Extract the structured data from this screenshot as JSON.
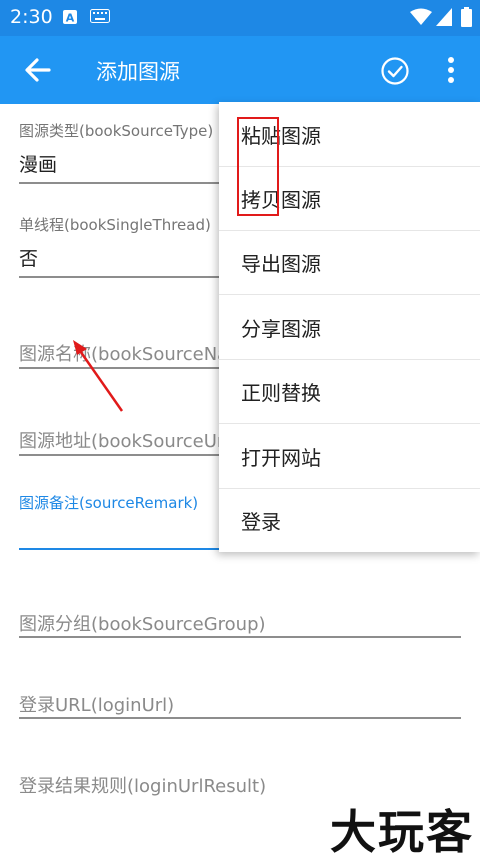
{
  "status_bar": {
    "time": "2:30"
  },
  "app_bar": {
    "title": "添加图源"
  },
  "fields": [
    {
      "label": "图源类型(bookSourceType)",
      "value": "漫画"
    },
    {
      "label": "单线程(bookSingleThread)",
      "value": "否"
    },
    {
      "placeholder": "图源名称(bookSourceName)"
    },
    {
      "placeholder": "图源地址(bookSourceUrl)"
    },
    {
      "label": "图源备注(sourceRemark)",
      "value": ""
    },
    {
      "placeholder": "图源分组(bookSourceGroup)"
    },
    {
      "placeholder": "登录URL(loginUrl)"
    },
    {
      "placeholder": "登录结果规则(loginUrlResult)"
    }
  ],
  "menu": {
    "items": [
      "粘贴图源",
      "拷贝图源",
      "导出图源",
      "分享图源",
      "正则替换",
      "打开网站",
      "登录"
    ]
  },
  "annotation": {
    "highlight_color": "#e11a1a"
  },
  "watermark": "大玩客",
  "colors": {
    "status_bar": "#1e88e5",
    "app_bar": "#2196f3",
    "accent": "#1e88e5"
  }
}
